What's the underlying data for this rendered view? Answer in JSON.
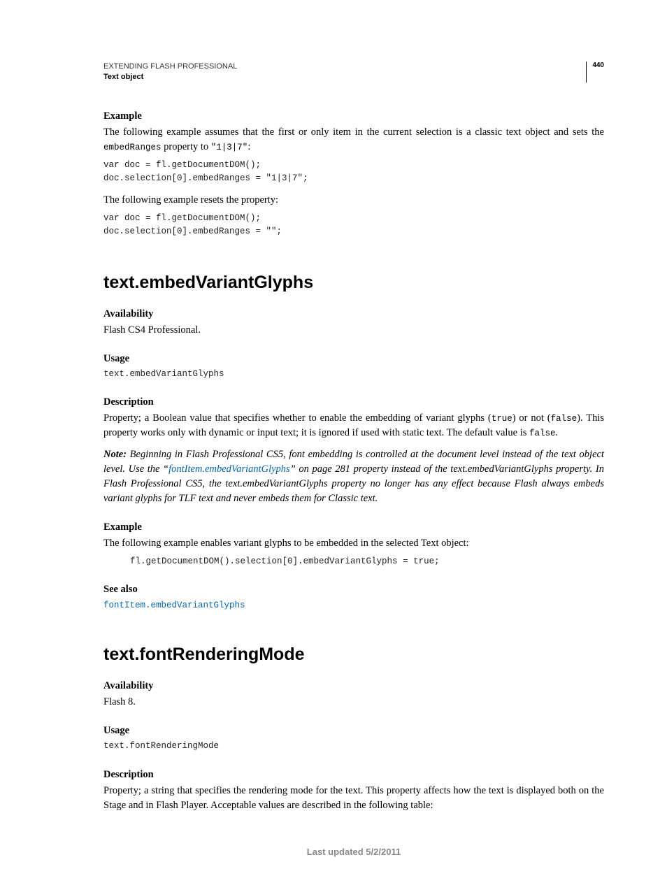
{
  "header": {
    "title": "EXTENDING FLASH PROFESSIONAL",
    "subtitle": "Text object",
    "page_number": "440"
  },
  "sec0": {
    "example_label": "Example",
    "example_intro_a": "The following example assumes that the first or only item in the current selection is a classic text object and sets the ",
    "example_intro_code": "embedRanges",
    "example_intro_b": " property to ",
    "example_intro_quote": "\"1|3|7\"",
    "example_intro_c": ":",
    "code1": "var doc = fl.getDocumentDOM();\ndoc.selection[0].embedRanges = \"1|3|7\";",
    "reset_intro": "The following example resets the property:",
    "code2": "var doc = fl.getDocumentDOM();\ndoc.selection[0].embedRanges = \"\";"
  },
  "sec1": {
    "heading": "text.embedVariantGlyphs",
    "avail_label": "Availability",
    "avail_text": "Flash CS4 Professional.",
    "usage_label": "Usage",
    "usage_code": "text.embedVariantGlyphs",
    "desc_label": "Description",
    "desc_a": "Property; a Boolean value that specifies whether to enable the embedding of variant glyphs (",
    "desc_true": "true",
    "desc_b": ") or not (",
    "desc_false": "false",
    "desc_c": "). This property works only with dynamic or input text; it is ignored if used with static text. The default value is ",
    "desc_false2": "false",
    "desc_d": ".",
    "note_bold": "Note:",
    "note_a": " Beginning in Flash Professional CS5, font embedding is controlled at the document level instead of the text object level. Use the “",
    "note_link": "fontItem.embedVariantGlyphs",
    "note_b": "” on page 281 property instead of the text.embedVariantGlyphs property. In Flash Professional CS5, the text.embedVariantGlyphs property no longer has any effect because Flash always embeds variant glyphs for TLF text and never embeds them for Classic text.",
    "example_label": "Example",
    "example_text": "The following example enables variant glyphs to be embedded in the selected Text object:",
    "example_code": "fl.getDocumentDOM().selection[0].embedVariantGlyphs = true;",
    "seealso_label": "See also",
    "seealso_link": "fontItem.embedVariantGlyphs"
  },
  "sec2": {
    "heading": "text.fontRenderingMode",
    "avail_label": "Availability",
    "avail_text": "Flash 8.",
    "usage_label": "Usage",
    "usage_code": "text.fontRenderingMode",
    "desc_label": "Description",
    "desc_text": "Property; a string that specifies the rendering mode for the text. This property affects how the text is displayed both on the Stage and in Flash Player. Acceptable values are described in the following table:"
  },
  "footer": {
    "updated": "Last updated 5/2/2011"
  }
}
